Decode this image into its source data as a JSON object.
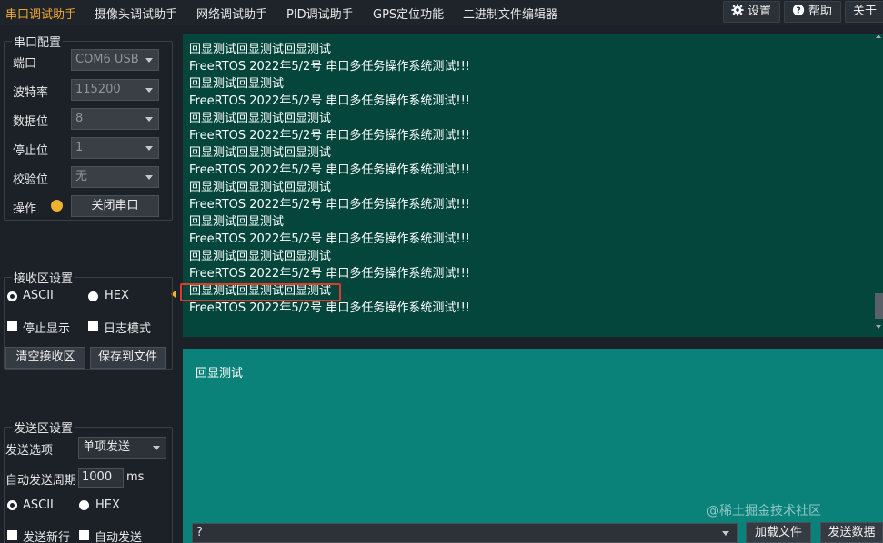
{
  "menu": {
    "items": [
      "串口调试助手",
      "摄像头调试助手",
      "网络调试助手",
      "PID调试助手",
      "GPS定位功能",
      "二进制文件编辑器"
    ],
    "active_index": 0,
    "settings_label": "设置",
    "help_label": "帮助",
    "about_label": "关于",
    "settings_icon": "gear-icon",
    "help_icon": "question-icon"
  },
  "serial_config": {
    "title": "串口配置",
    "port_label": "端口",
    "port_value": "COM6 USB",
    "baud_label": "波特率",
    "baud_value": "115200",
    "databits_label": "数据位",
    "databits_value": "8",
    "stopbits_label": "停止位",
    "stopbits_value": "1",
    "parity_label": "校验位",
    "parity_value": "无",
    "op_label": "操作",
    "close_port_label": "关闭串口",
    "status_color": "#f0b030"
  },
  "receive_settings": {
    "title": "接收区设置",
    "ascii_label": "ASCII",
    "hex_label": "HEX",
    "selected_mode": "ASCII",
    "stop_display_label": "停止显示",
    "log_mode_label": "日志模式",
    "clear_label": "清空接收区",
    "save_label": "保存到文件"
  },
  "send_settings": {
    "title": "发送区设置",
    "option_label": "发送选项",
    "option_value": "单项发送",
    "period_label": "自动发送周期",
    "period_value": "1000",
    "period_unit": "ms",
    "ascii_label": "ASCII",
    "hex_label": "HEX",
    "selected_mode": "ASCII",
    "newline_label": "发送新行",
    "auto_send_label": "自动发送"
  },
  "receive": {
    "lines": [
      "回显测试回显测试回显测试",
      " FreeRTOS 2022年5/2号 串口多任务操作系统测试!!!",
      "回显测试回显测试",
      " FreeRTOS 2022年5/2号 串口多任务操作系统测试!!!",
      "回显测试回显测试回显测试",
      " FreeRTOS 2022年5/2号 串口多任务操作系统测试!!!",
      "回显测试回显测试回显测试",
      " FreeRTOS 2022年5/2号 串口多任务操作系统测试!!!",
      "回显测试回显测试回显测试",
      " FreeRTOS 2022年5/2号 串口多任务操作系统测试!!!",
      "回显测试回显测试",
      " FreeRTOS 2022年5/2号 串口多任务操作系统测试!!!",
      "回显测试回显测试回显测试",
      " FreeRTOS 2022年5/2号 串口多任务操作系统测试!!!",
      "回显测试回显测试回显测试",
      " FreeRTOS 2022年5/2号 串口多任务操作系统测试!!!"
    ],
    "background": "#04463c"
  },
  "send": {
    "text": "回显测试",
    "history_value": "?",
    "load_file_label": "加载文件",
    "send_data_label": "发送数据",
    "background": "#0a827a"
  },
  "watermark": "@稀土掘金技术社区"
}
